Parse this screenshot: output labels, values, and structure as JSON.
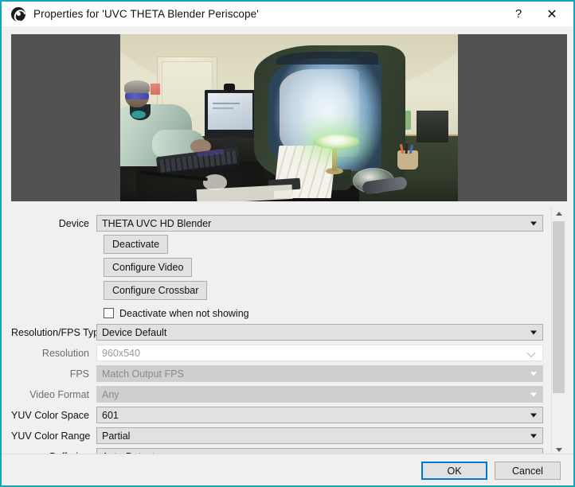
{
  "window": {
    "title": "Properties for 'UVC THETA Blender Periscope'",
    "app_icon": "obs-logo-icon",
    "border_color": "#17a2bd",
    "help_label": "?",
    "close_label": "✕"
  },
  "preview": {
    "name": "video-preview",
    "letterbox_color": "#525252",
    "description": "360 degree equirectangular webcam view of an office: person at a desk with glasses, large curved monitor, secondary monitor, keyboard, mouse, desk lamp with green glow, papers and glass bowl"
  },
  "form": {
    "device": {
      "label": "Device",
      "value": "THETA UVC HD Blender",
      "enabled": true
    },
    "deactivate_button": "Deactivate",
    "configure_video_button": "Configure Video",
    "configure_crossbar_button": "Configure Crossbar",
    "deactivate_when_not_showing": {
      "label": "Deactivate when not showing",
      "checked": false
    },
    "resolution_fps_type": {
      "label": "Resolution/FPS Type",
      "value": "Device Default",
      "enabled": true
    },
    "resolution": {
      "label": "Resolution",
      "value": "960x540",
      "enabled": false
    },
    "fps": {
      "label": "FPS",
      "value": "Match Output FPS",
      "enabled": false
    },
    "video_format": {
      "label": "Video Format",
      "value": "Any",
      "enabled": false
    },
    "yuv_color_space": {
      "label": "YUV Color Space",
      "value": "601",
      "enabled": true
    },
    "yuv_color_range": {
      "label": "YUV Color Range",
      "value": "Partial",
      "enabled": true
    },
    "buffering": {
      "label": "Buffering",
      "value": "Auto-Detect",
      "enabled": true
    }
  },
  "scrollbar": {
    "up_arrow": "∧",
    "down_arrow": "∨"
  },
  "footer": {
    "ok_label": "OK",
    "cancel_label": "Cancel",
    "accent_color": "#0078d7"
  }
}
